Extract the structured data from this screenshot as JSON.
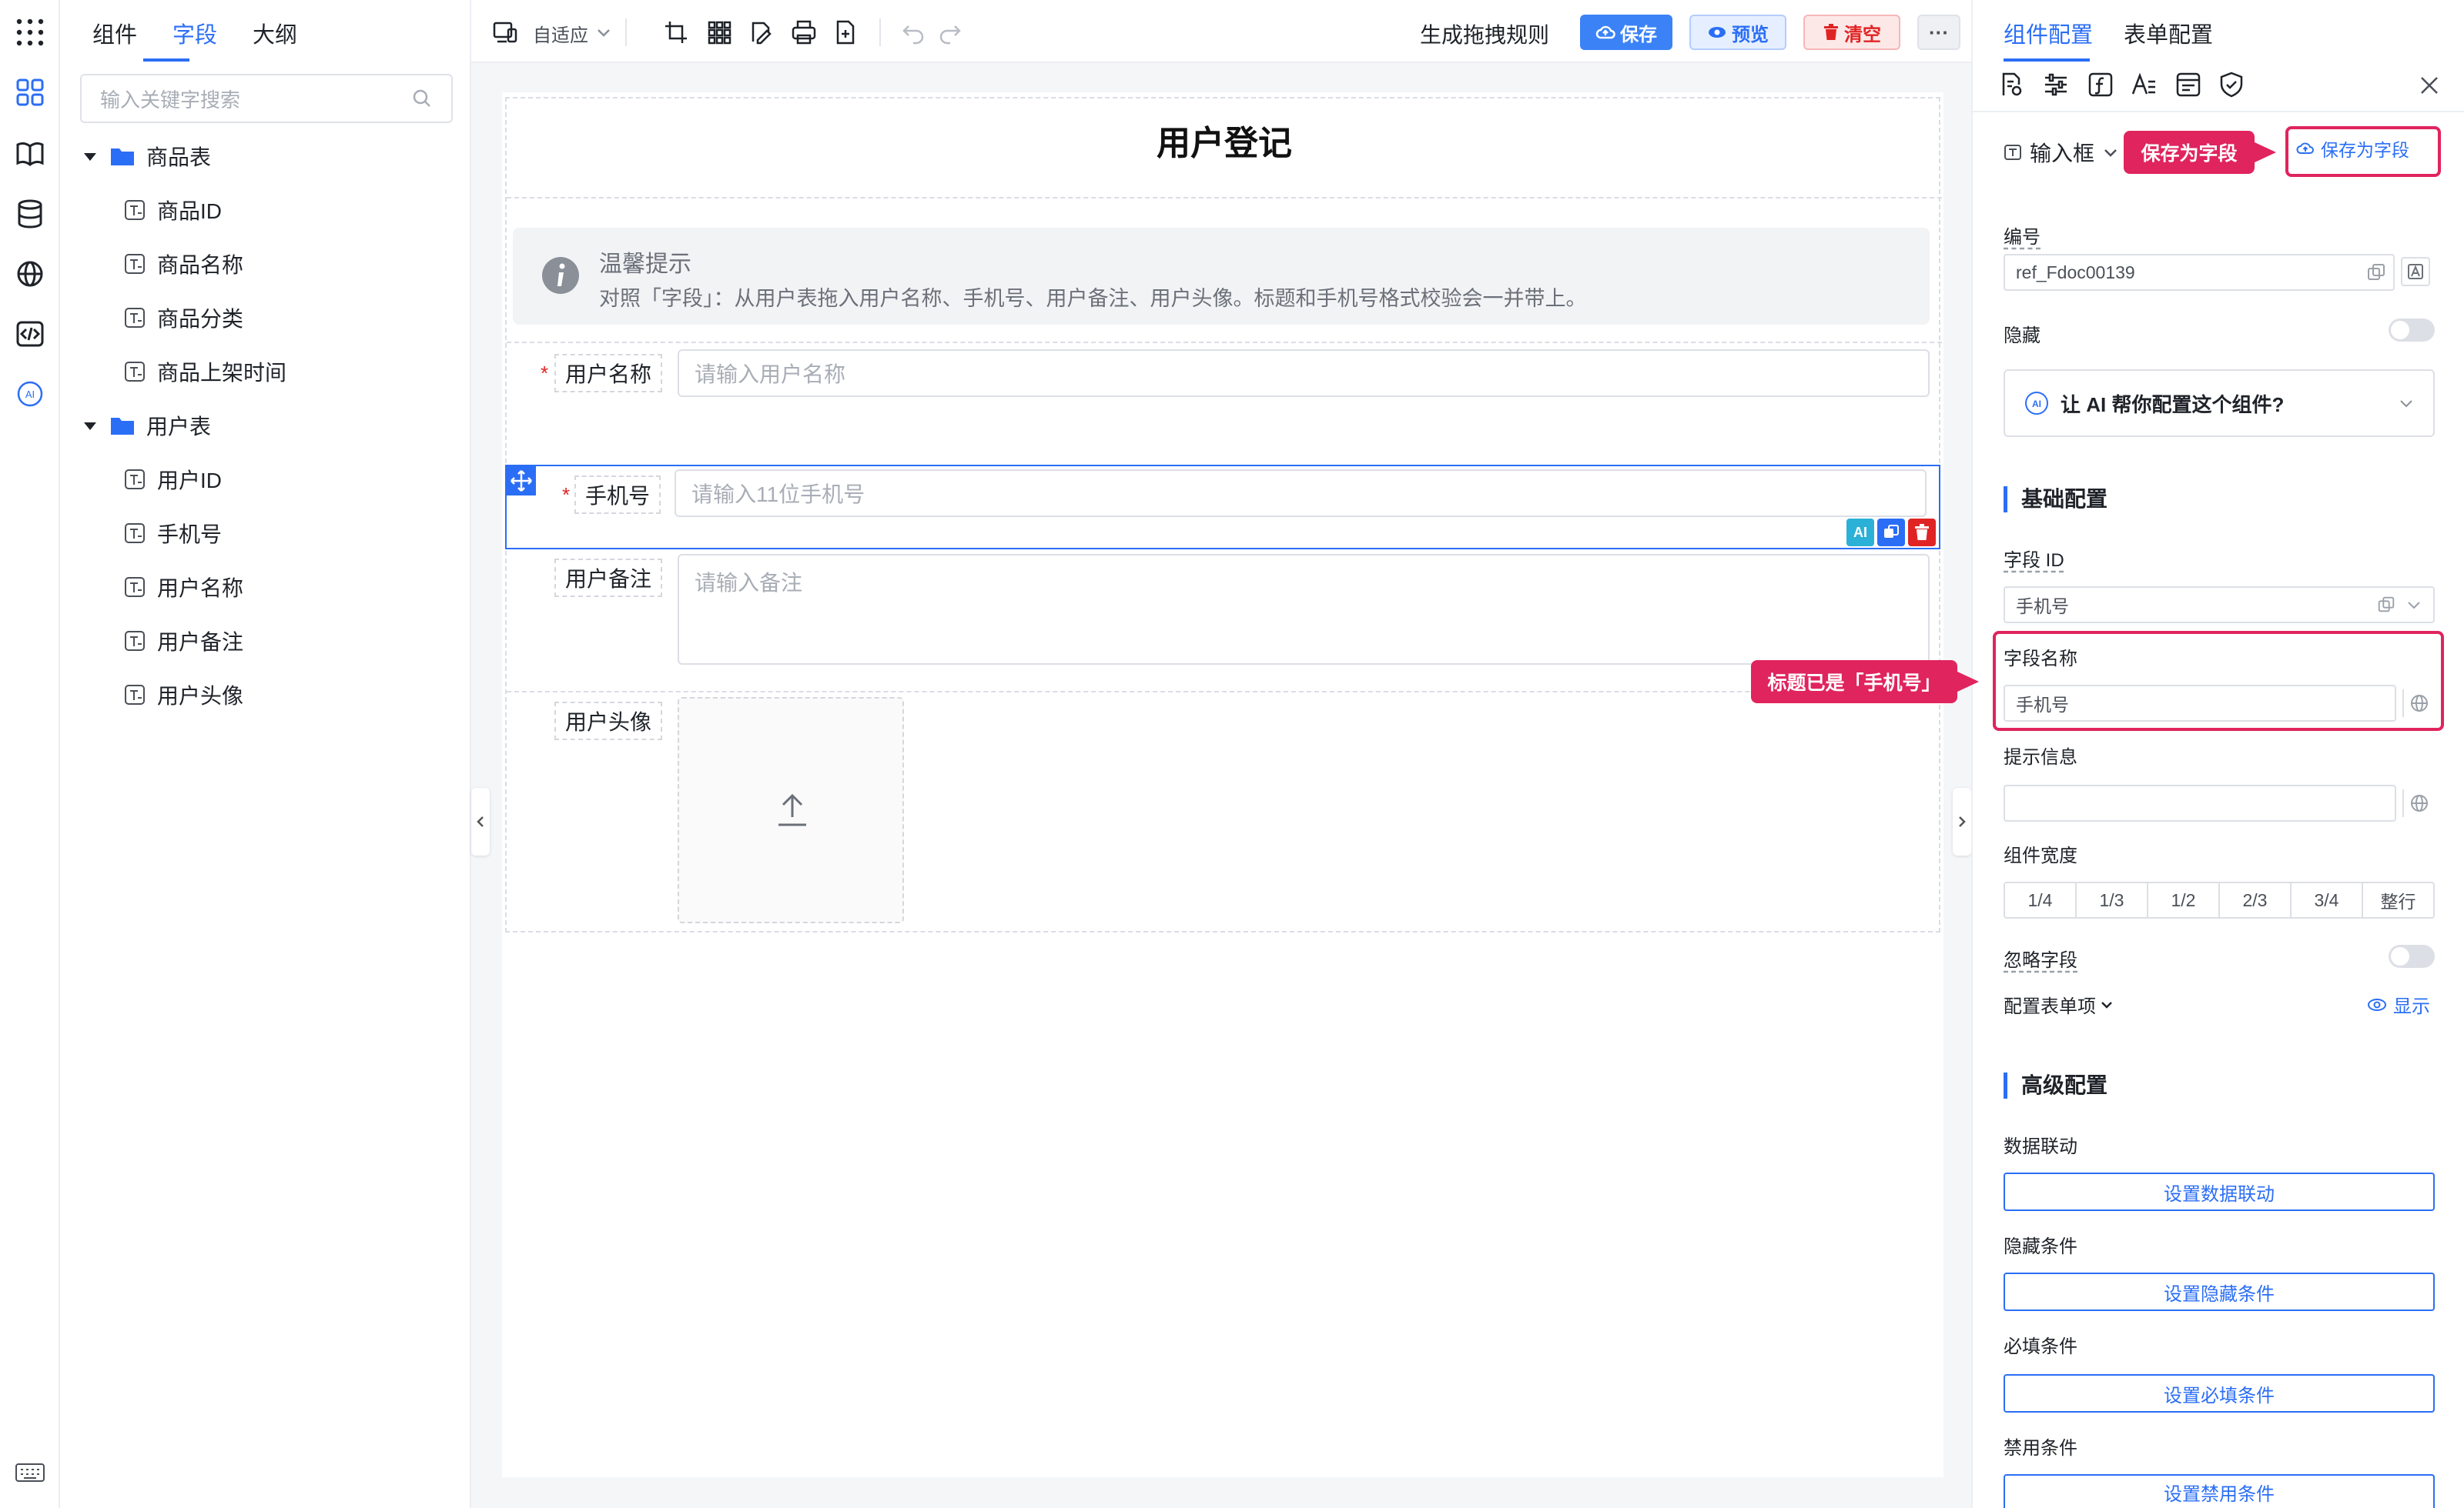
{
  "left_panel": {
    "tabs": [
      "组件",
      "字段",
      "大纲"
    ],
    "active_tab": 1,
    "search_placeholder": "输入关键字搜索",
    "tree": [
      {
        "label": "商品表",
        "children": [
          "商品ID",
          "商品名称",
          "商品分类",
          "商品上架时间"
        ]
      },
      {
        "label": "用户表",
        "children": [
          "用户ID",
          "手机号",
          "用户名称",
          "用户备注",
          "用户头像"
        ]
      }
    ]
  },
  "toolbar": {
    "device_label": "自适应",
    "gen_rules": "生成拖拽规则",
    "save": "保存",
    "preview": "预览",
    "clear": "清空",
    "more": "···"
  },
  "canvas": {
    "form_title": "用户登记",
    "notice_title": "温馨提示",
    "notice_desc": "对照「字段」：从用户表拖入用户名称、手机号、用户备注、用户头像。标题和手机号格式校验会一并带上。",
    "fields": {
      "username": {
        "label": "用户名称",
        "placeholder": "请输入用户名称",
        "required": "*"
      },
      "phone": {
        "label": "手机号",
        "placeholder": "请输入11位手机号",
        "required": "*"
      },
      "remark": {
        "label": "用户备注",
        "placeholder": "请输入备注"
      },
      "avatar": {
        "label": "用户头像"
      }
    },
    "row_actions": {
      "ai": "AI"
    }
  },
  "right_panel": {
    "tabs": [
      "组件配置",
      "表单配置"
    ],
    "component_type": "输入框",
    "save_as_field": "保存为字段",
    "id_label": "编号",
    "id_value": "ref_Fdoc00139",
    "hidden_label": "隐藏",
    "ai_prompt": "让 AI 帮你配置这个组件?",
    "basic_title": "基础配置",
    "field_id_label": "字段 ID",
    "field_id_value": "手机号",
    "field_name_label": "字段名称",
    "field_name_value": "手机号",
    "tip_label": "提示信息",
    "width_label": "组件宽度",
    "width_options": [
      "1/4",
      "1/3",
      "1/2",
      "2/3",
      "3/4",
      "整行"
    ],
    "ignore_label": "忽略字段",
    "form_item_label": "配置表单项",
    "show_label": "显示",
    "advanced_title": "高级配置",
    "linkage_label": "数据联动",
    "linkage_btn": "设置数据联动",
    "hide_cond_label": "隐藏条件",
    "hide_cond_btn": "设置隐藏条件",
    "required_cond_label": "必填条件",
    "required_cond_btn": "设置必填条件",
    "disabled_cond_label": "禁用条件",
    "disabled_cond_btn": "设置禁用条件"
  },
  "annotations": {
    "save_field_tag": "保存为字段",
    "title_tag": "标题已是「手机号」"
  },
  "colors": {
    "accent": "#2b6ef6",
    "danger": "#e02424",
    "callout": "#e0245e"
  }
}
